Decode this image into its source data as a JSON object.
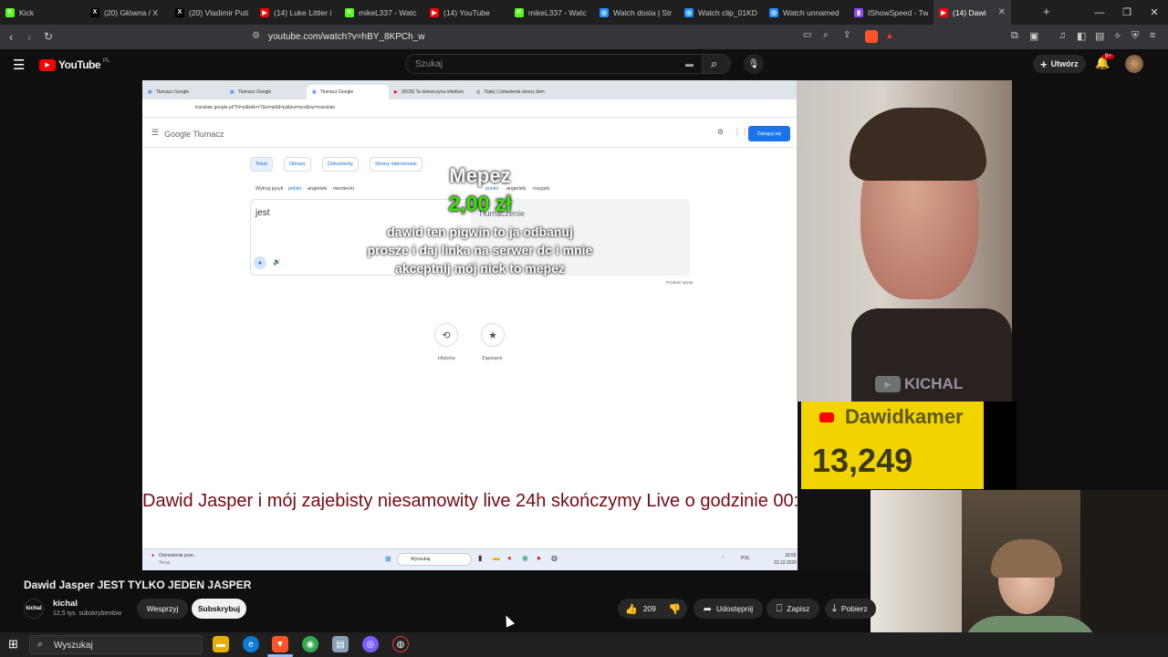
{
  "browser": {
    "tabs": [
      {
        "label": "Kick",
        "color": "#53fc18",
        "icon": "kick-icon",
        "glyph": "K"
      },
      {
        "label": "(20) Główna / X",
        "color": "#000000",
        "icon": "x-icon",
        "glyph": "X"
      },
      {
        "label": "(20) Vladimir Puti",
        "color": "#000000",
        "icon": "x-icon",
        "glyph": "X"
      },
      {
        "label": "(14) Luke Littler i",
        "color": "#ff0000",
        "icon": "youtube-icon",
        "glyph": "▶"
      },
      {
        "label": "mikeL337 - Watc",
        "color": "#53fc18",
        "icon": "kick-icon",
        "glyph": "K"
      },
      {
        "label": "(14) YouTube",
        "color": "#ff0000",
        "icon": "youtube-icon",
        "glyph": "▶"
      },
      {
        "label": "mikeL337 - Watc",
        "color": "#53fc18",
        "icon": "kick-icon",
        "glyph": "K"
      },
      {
        "label": "Watch dosia | Str",
        "color": "#1e90ff",
        "icon": "globe-icon",
        "glyph": "◎"
      },
      {
        "label": "Watch clip_01KD",
        "color": "#1e90ff",
        "icon": "globe-icon",
        "glyph": "◎"
      },
      {
        "label": "Watch unnamed",
        "color": "#1e90ff",
        "icon": "globe-icon",
        "glyph": "◎"
      },
      {
        "label": "IShowSpeed - Tw",
        "color": "#9146ff",
        "icon": "twitch-icon",
        "glyph": "▮"
      },
      {
        "label": "(14) Dawi",
        "color": "#ff0000",
        "icon": "youtube-icon",
        "glyph": "▶"
      }
    ],
    "url": "youtube.com/watch?v=hBY_8KPCh_w"
  },
  "youtube": {
    "logo": "YouTube",
    "region": "PL",
    "search_placeholder": "Szukaj",
    "create_label": "Utwórz",
    "notifications_badge": "9+"
  },
  "shared_screen": {
    "inner_tabs": [
      "Tłumacz Google",
      "Tłumacz Google",
      "Tłumacz Google",
      "(5039) Ta dziewczyna młodsze",
      "Topkj | Ustawienia strony dom"
    ],
    "inner_url": "translate.google.pl/?hl=pl&tab=rT&sl=pl&tl=ja&text=jest&op=translate",
    "logo": "Google Tłumacz",
    "login_label": "Zaloguj się",
    "modes": [
      "Tekst",
      "Obrazy",
      "Dokumenty",
      "Strony internetowe"
    ],
    "source_langs": [
      "Wykryj język",
      "polski",
      "angielski",
      "niemiecki"
    ],
    "target_langs": [
      "polski",
      "angielski",
      "rosyjski"
    ],
    "source_text": "jest",
    "target_placeholder": "Tłumaczenie",
    "feedback": "Przekaż opinię",
    "history_label": "Historia",
    "saved_label": "Zapisane",
    "taskbar_search": "Wyszukaj",
    "taskbar_notice": "Ostrzeżenie prze...",
    "taskbar_notice_sub": "Teraz",
    "taskbar_lang": "POL",
    "taskbar_time": "18:55",
    "taskbar_date": "23.12.2025"
  },
  "donation": {
    "name": "Mepez",
    "amount": "2,00 zł",
    "message": "dawid ten pigwin to ja odbanuj prosze i daj linka na serwer dc i mnie akceptnij mój nick to mepez"
  },
  "ticker": "Dawid Jasper i mój zajebisty niesamowity live 24h skończymy Live o godzinie 00:01",
  "overlay": {
    "watermark": "KICHAL",
    "sub_channel": "Dawidkamer",
    "sub_count": "13,249"
  },
  "video": {
    "title": "Dawid Jasper JEST TYLKO JEDEN JASPER",
    "channel": "kichal",
    "channel_avatar_text": "kichal",
    "subscribers": "12,5 tys. subskrybentów",
    "support_label": "Wesprzyj",
    "subscribe_label": "Subskrybuj",
    "likes": "209",
    "share_label": "Udostępnij",
    "save_label": "Zapisz",
    "download_label": "Pobierz"
  },
  "taskbar": {
    "search_label": "Wyszukaj"
  },
  "colors": {
    "youtube_red": "#ff0000",
    "ticker_red": "#7a0a14",
    "donation_green": "#39e600",
    "google_blue": "#1a73e8"
  }
}
